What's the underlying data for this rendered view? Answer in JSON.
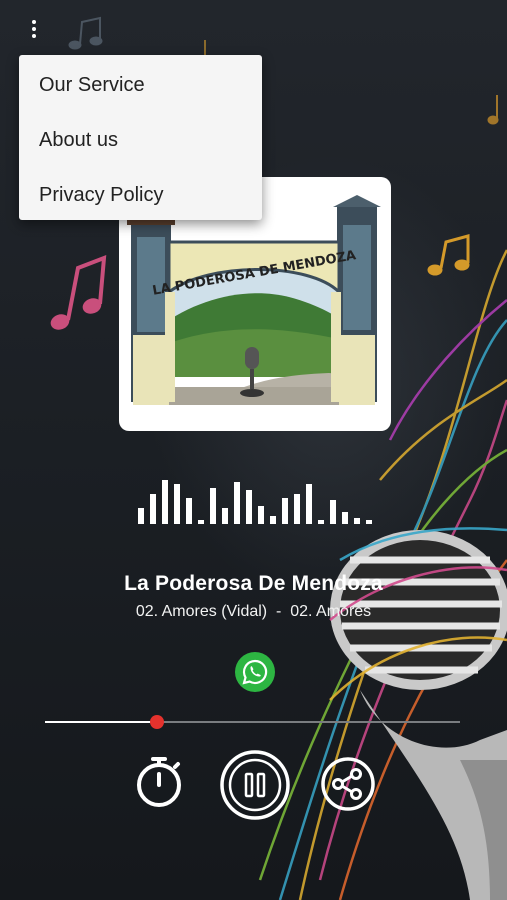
{
  "menu": {
    "items": [
      "Our Service",
      "About us",
      "Privacy Policy"
    ]
  },
  "artwork": {
    "arch_text": "LA PODEROSA DE MENDOZA"
  },
  "player": {
    "station_name": "La Poderosa De Mendoza",
    "track_title": "02. Amores (Vidal)  -  02. Amores",
    "progress": 0.27
  },
  "colors": {
    "accent": "#e5322d",
    "whatsapp": "#2db642"
  },
  "icons": {
    "timer": "stopwatch-icon",
    "play_pause": "pause-icon",
    "share": "share-icon",
    "whatsapp": "whatsapp-icon",
    "overflow": "more-vert-icon"
  }
}
